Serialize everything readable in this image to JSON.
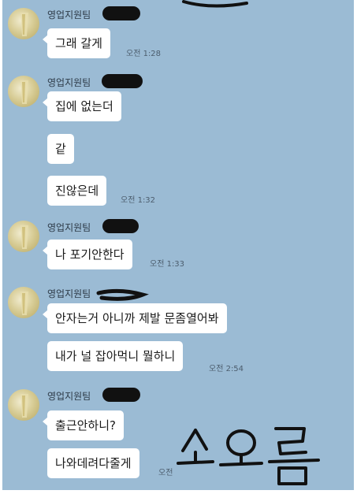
{
  "chat": {
    "groups": [
      {
        "sender": "영업지원팀",
        "messages": [
          {
            "text": "그래 갈게",
            "time": "오전 1:28"
          }
        ]
      },
      {
        "sender": "영업지원팀",
        "messages": [
          {
            "text": "집에 없는더",
            "time": ""
          },
          {
            "text": "같",
            "time": ""
          },
          {
            "text": "진않은데",
            "time": "오전 1:32"
          }
        ]
      },
      {
        "sender": "영업지원팀",
        "messages": [
          {
            "text": "나 포기안한다",
            "time": "오전 1:33"
          }
        ]
      },
      {
        "sender": "영업지원팀",
        "messages": [
          {
            "text": "안자는거 아니까 제발 문좀열어봐",
            "time": ""
          },
          {
            "text": "내가 널 잡아먹니 뭘하니",
            "time": "오전 2:54"
          }
        ]
      },
      {
        "sender": "영업지원팀",
        "messages": [
          {
            "text": "출근안하니?",
            "time": ""
          },
          {
            "text": "나와데려다줄게",
            "time": "오전"
          }
        ]
      }
    ],
    "signature_text": "소오름"
  },
  "colors": {
    "background": "#9bbbd4",
    "bubble": "#ffffff",
    "redaction": "#111111"
  },
  "icons": {
    "avatar": "profile-photo",
    "redaction": "black-marker-scribble"
  }
}
